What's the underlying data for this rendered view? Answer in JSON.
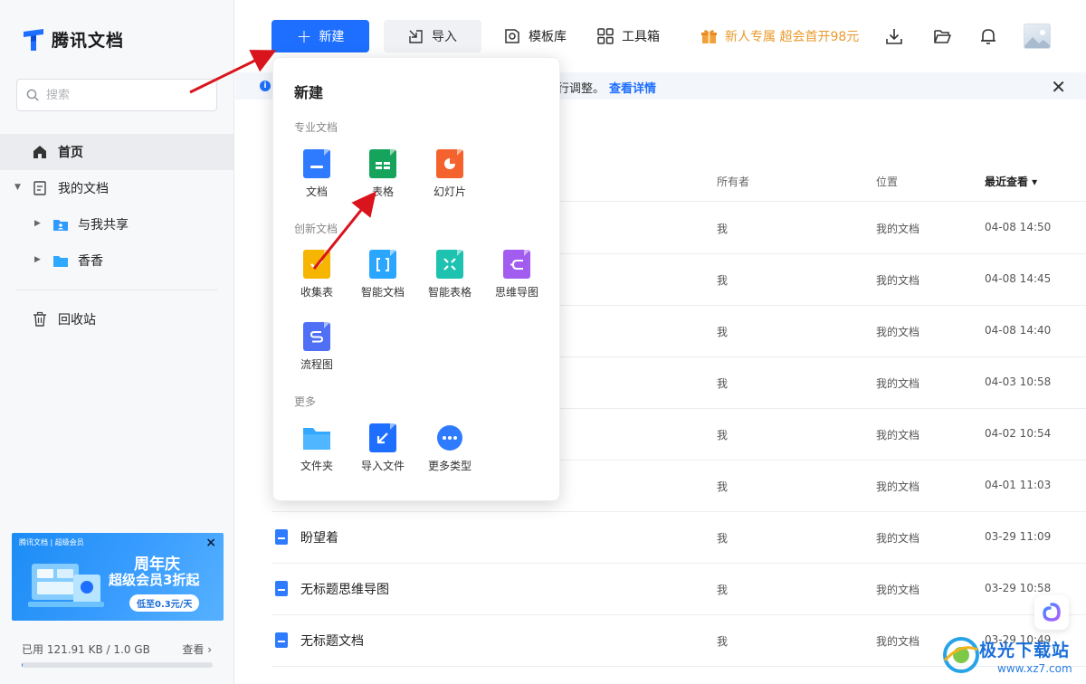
{
  "app": {
    "name": "腾讯文档"
  },
  "sidebar": {
    "search_placeholder": "搜索",
    "items": [
      {
        "label": "首页"
      },
      {
        "label": "我的文档"
      },
      {
        "label": "与我共享"
      },
      {
        "label": "香香"
      },
      {
        "label": "回收站"
      }
    ],
    "promo": {
      "brand": "腾讯文档 | 超级会员",
      "title1": "周年庆",
      "title2": "超级会员3折起",
      "pill": "低至0.3元/天",
      "close": "×"
    },
    "storage": {
      "text": "已用 121.91 KB / 1.0 GB",
      "view": "查看 ›",
      "used_fraction": 0.0001
    }
  },
  "toolbar": {
    "new_label": "新建",
    "import_label": "导入",
    "templates_label": "模板库",
    "toolbox_label": "工具箱",
    "promo_label": "新人专属 超会首开98元"
  },
  "notice": {
    "text": "行调整。",
    "link": "查看详情"
  },
  "table": {
    "headers": {
      "owner": "所有者",
      "location": "位置",
      "recent": "最近查看 ▾"
    },
    "rows": [
      {
        "name": "",
        "owner": "我",
        "location": "我的文档",
        "time": "04-08 14:50"
      },
      {
        "name": "",
        "owner": "我",
        "location": "我的文档",
        "time": "04-08 14:45"
      },
      {
        "name": "",
        "owner": "我",
        "location": "我的文档",
        "time": "04-08 14:40"
      },
      {
        "name": "",
        "owner": "我",
        "location": "我的文档",
        "time": "04-03 10:58"
      },
      {
        "name": "",
        "owner": "我",
        "location": "我的文档",
        "time": "04-02 10:54"
      },
      {
        "name": "",
        "owner": "我",
        "location": "我的文档",
        "time": "04-01 11:03"
      },
      {
        "name": "盼望着",
        "owner": "我",
        "location": "我的文档",
        "time": "03-29 11:09"
      },
      {
        "name": "无标题思维导图",
        "owner": "我",
        "location": "我的文档",
        "time": "03-29 10:58"
      },
      {
        "name": "无标题文档",
        "owner": "我",
        "location": "我的文档",
        "time": "03-29 10:49"
      }
    ]
  },
  "new_menu": {
    "title": "新建",
    "sections": [
      {
        "label": "专业文档",
        "items": [
          {
            "label": "文档"
          },
          {
            "label": "表格"
          },
          {
            "label": "幻灯片"
          }
        ]
      },
      {
        "label": "创新文档",
        "items": [
          {
            "label": "收集表"
          },
          {
            "label": "智能文档"
          },
          {
            "label": "智能表格"
          },
          {
            "label": "思维导图"
          },
          {
            "label": "流程图"
          }
        ]
      },
      {
        "label": "更多",
        "items": [
          {
            "label": "文件夹"
          },
          {
            "label": "导入文件"
          },
          {
            "label": "更多类型"
          }
        ]
      }
    ]
  },
  "watermark": {
    "text": "极光下载站",
    "url": "www.xz7.com"
  },
  "colors": {
    "accent": "#1e6fff",
    "promo_text": "#e89a2c",
    "annotation_arrow": "#d9141c"
  }
}
